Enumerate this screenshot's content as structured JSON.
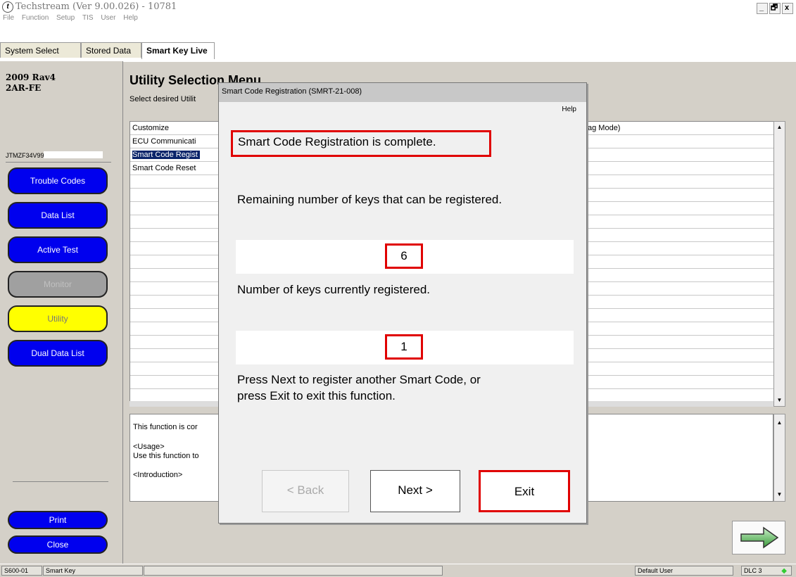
{
  "window": {
    "title": "Techstream (Ver 9.00.026) - 10781",
    "icon_glyph": "t",
    "controls": [
      "_",
      "🗗",
      "x"
    ]
  },
  "menu": [
    "File",
    "Function",
    "Setup",
    "TIS",
    "User",
    "Help"
  ],
  "tabs": [
    "System Select",
    "Stored Data",
    "Smart Key Live"
  ],
  "vehicle": {
    "line1": "2009 Rav4",
    "line2": "2AR-FE",
    "vin": "JTMZF34V99"
  },
  "nav": {
    "trouble_codes": "Trouble Codes",
    "data_list": "Data List",
    "active_test": "Active Test",
    "monitor": "Monitor",
    "utility": "Utility",
    "dual_data_list": "Dual Data List",
    "print": "Print",
    "close": "Close"
  },
  "main": {
    "title": "Utility Selection Menu",
    "subtitle": "Select desired Utilit",
    "list_items": [
      "Customize",
      "ECU Communicati",
      "Smart Code Regist",
      "Smart Code Reset"
    ],
    "list_item_right": "ag Mode)",
    "selected_index": 2,
    "description": [
      "This function is cor",
      "<Usage>",
      "Use this function to",
      "<Introduction>"
    ]
  },
  "dialog": {
    "title": "Smart Code Registration (SMRT-21-008)",
    "help": "Help",
    "complete_message": "Smart Code Registration is complete.",
    "remaining_label": "Remaining number of keys that can be registered.",
    "remaining_value": "6",
    "registered_label": "Number of keys currently registered.",
    "registered_value": "1",
    "instruction_line1": "Press Next to register another Smart Code, or",
    "instruction_line2": "press Exit to exit this function.",
    "back_label": "< Back",
    "next_label": "Next >",
    "exit_label": "Exit"
  },
  "status": {
    "code": "S600-01",
    "name": "Smart Key",
    "user": "Default User",
    "connection": "DLC 3"
  },
  "colors": {
    "nav_blue": "#0000ee",
    "utility_yellow": "#ffff00",
    "monitor_gray": "#a0a0a0",
    "selection": "#0a246a",
    "highlight_red": "#e00000",
    "status_green": "#33cc33"
  }
}
